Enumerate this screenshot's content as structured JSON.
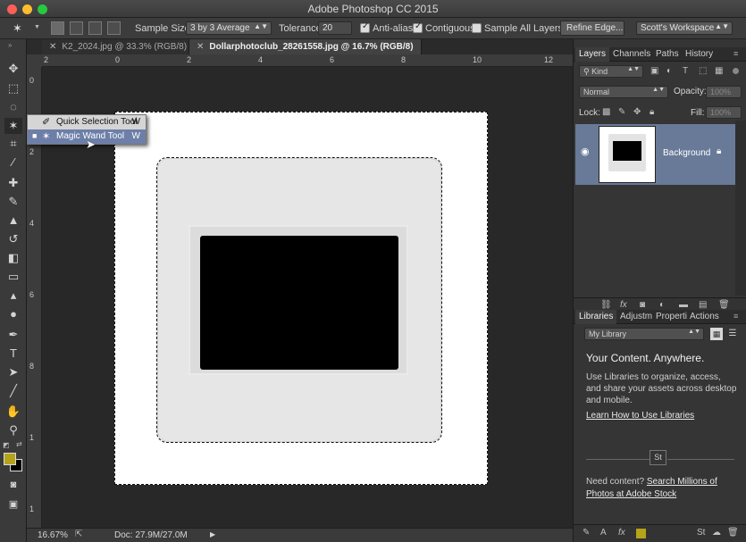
{
  "window": {
    "title": "Adobe Photoshop CC 2015"
  },
  "options_bar": {
    "sample_size_label": "Sample Size:",
    "sample_size_value": "3 by 3 Average",
    "tolerance_label": "Tolerance:",
    "tolerance_value": "20",
    "anti_alias_label": "Anti-alias",
    "contiguous_label": "Contiguous",
    "sample_all_layers_label": "Sample All Layers",
    "refine_edge_label": "Refine Edge...",
    "workspace_value": "Scott's Workspace",
    "anti_alias_checked": true,
    "contiguous_checked": true,
    "sample_all_layers_checked": false
  },
  "doc_tabs": [
    {
      "label": "K2_2024.jpg @ 33.3% (RGB/8) *",
      "active": false
    },
    {
      "label": "Dollarphotoclub_28261558.jpg @ 16.7% (RGB/8)",
      "active": true
    }
  ],
  "ruler": {
    "h_labels": [
      "2",
      "0",
      "2",
      "4",
      "6",
      "8",
      "10",
      "12"
    ],
    "v_labels": [
      "0",
      "2",
      "4",
      "6",
      "8",
      "1",
      "1"
    ]
  },
  "flyout": {
    "items": [
      {
        "label": "Quick Selection Tool",
        "key": "W",
        "selected": false
      },
      {
        "label": "Magic Wand Tool",
        "key": "W",
        "selected": true
      }
    ]
  },
  "status_bar": {
    "zoom": "16.67%",
    "doc_info": "Doc: 27.9M/27.0M"
  },
  "layers_panel": {
    "tabs": [
      "Layers",
      "Channels",
      "Paths",
      "History"
    ],
    "filter_kind": "Kind",
    "blend_mode": "Normal",
    "opacity_label": "Opacity:",
    "opacity_value": "100%",
    "lock_label": "Lock:",
    "fill_label": "Fill:",
    "fill_value": "100%",
    "layers": [
      {
        "name": "Background"
      }
    ]
  },
  "libraries_panel": {
    "tabs": [
      "Libraries",
      "Adjustm",
      "Properti",
      "Actions"
    ],
    "library_value": "My Library",
    "heading": "Your Content. Anywhere.",
    "body": "Use Libraries to organize, access, and share your assets across desktop and mobile.",
    "learn_link": "Learn How to Use Libraries",
    "stock_badge": "St",
    "need_content": "Need content?",
    "stock_link": "Search Millions of Photos at Adobe Stock"
  },
  "colors": {
    "foreground": "#b5a31a",
    "background": "#000000",
    "selected_layer": "#697a98",
    "flyout_selected": "#6d7fa8"
  }
}
